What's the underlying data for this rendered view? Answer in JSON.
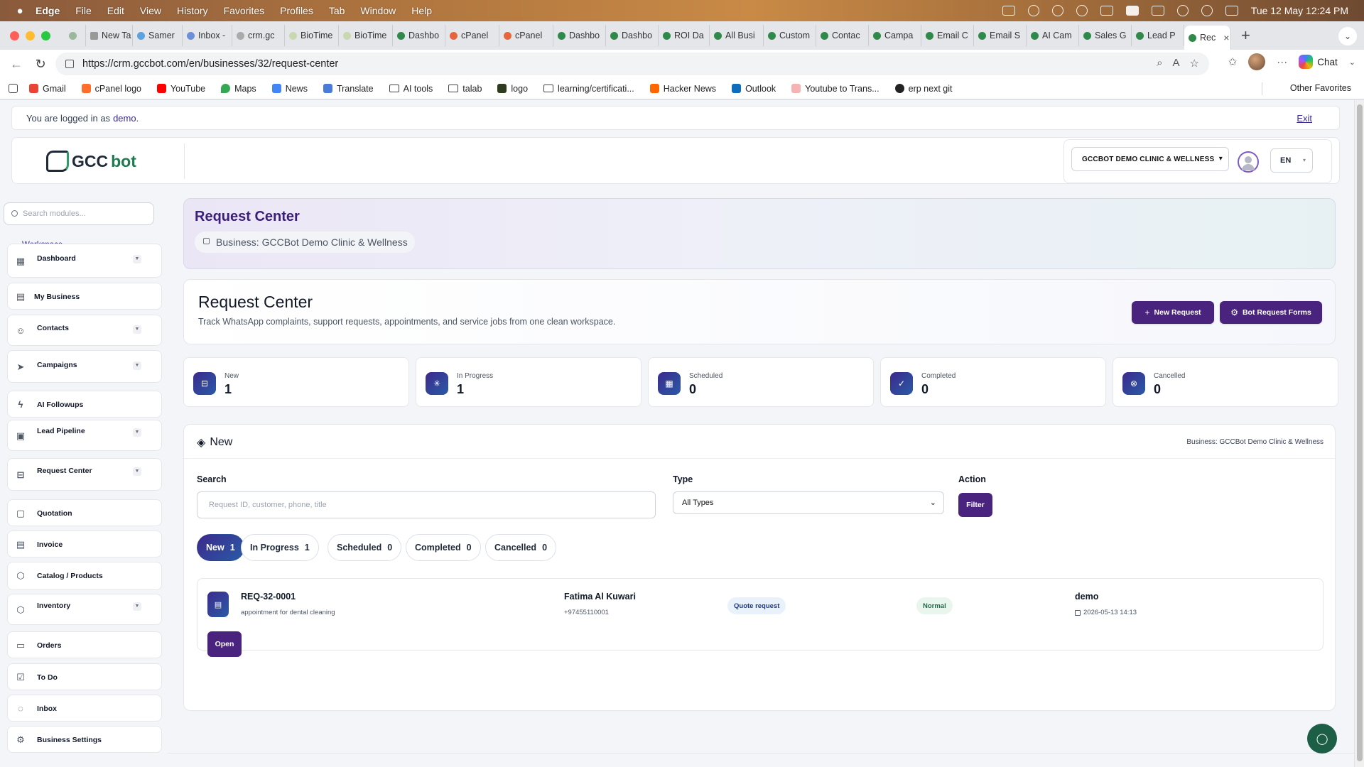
{
  "menubar": {
    "items": [
      "Edge",
      "File",
      "Edit",
      "View",
      "History",
      "Favorites",
      "Profiles",
      "Tab",
      "Window",
      "Help"
    ],
    "datetime": "Tue 12 May  12:24 PM"
  },
  "tabs": [
    "New Ta",
    "Samer",
    "Inbox -",
    "crm.gc",
    "BioTime",
    "BioTime",
    "Dashbo",
    "cPanel",
    "cPanel",
    "Dashbo",
    "Dashbo",
    "ROI Da",
    "All Busi",
    "Custom",
    "Contac",
    "Campa",
    "Email C",
    "Email S",
    "AI Cam",
    "Sales G",
    "Lead P"
  ],
  "active_tab": "Rec",
  "address": {
    "url": "https://crm.gccbot.com/en/businesses/32/request-center",
    "chat_label": "Chat"
  },
  "bookmarks": [
    "Gmail",
    "cPanel logo",
    "YouTube",
    "Maps",
    "News",
    "Translate",
    "AI tools",
    "talab",
    "logo",
    "learning/certificati...",
    "Hacker News",
    "Outlook",
    "Youtube to Trans...",
    "erp next git"
  ],
  "other_favorites": "Other Favorites",
  "login": {
    "prefix": "You are logged in as",
    "user": "demo",
    "suffix": ".",
    "exit": "Exit"
  },
  "header": {
    "logo_text_a": "GCC",
    "logo_text_b": "bot",
    "business_select": "GCCBOT DEMO CLINIC & WELLNESS",
    "language": "EN"
  },
  "sidebar": {
    "search_placeholder": "Search modules...",
    "section_label": "Workspace",
    "items": [
      {
        "label": "Dashboard",
        "icon": "grid-icon",
        "caret": true
      },
      {
        "label": "My Business",
        "icon": "building-icon",
        "caret": false
      },
      {
        "label": "Contacts",
        "icon": "users-icon",
        "caret": true
      },
      {
        "label": "Campaigns",
        "icon": "send-icon",
        "caret": true
      },
      {
        "label": "AI Followups",
        "icon": "bolt-icon",
        "caret": false
      },
      {
        "label": "Lead Pipeline",
        "icon": "briefcase-icon",
        "caret": true
      },
      {
        "label": "Request Center",
        "icon": "inbox-icon",
        "caret": true
      },
      {
        "label": "Quotation",
        "icon": "file-icon",
        "caret": false
      },
      {
        "label": "Invoice",
        "icon": "file-text-icon",
        "caret": false
      },
      {
        "label": "Catalog / Products",
        "icon": "box-icon",
        "caret": false
      },
      {
        "label": "Inventory",
        "icon": "package-icon",
        "caret": true
      },
      {
        "label": "Orders",
        "icon": "bag-icon",
        "caret": false
      },
      {
        "label": "To Do",
        "icon": "check-square-icon",
        "caret": false
      },
      {
        "label": "Inbox",
        "icon": "whatsapp-icon",
        "caret": false
      },
      {
        "label": "Business Settings",
        "icon": "gear-icon",
        "caret": false
      }
    ]
  },
  "hero": {
    "title": "Request Center",
    "business_chip": "Business: GCCBot Demo Clinic & Wellness"
  },
  "title_card": {
    "title": "Request Center",
    "subtitle": "Track WhatsApp complaints, support requests, appointments, and service jobs from one clean workspace.",
    "new_request": "New Request",
    "bot_forms": "Bot Request Forms"
  },
  "stats": [
    {
      "label": "New",
      "value": "1",
      "icon": "inbox-icon"
    },
    {
      "label": "In Progress",
      "value": "1",
      "icon": "spinner-icon"
    },
    {
      "label": "Scheduled",
      "value": "0",
      "icon": "calendar-icon"
    },
    {
      "label": "Completed",
      "value": "0",
      "icon": "check-circle-icon"
    },
    {
      "label": "Cancelled",
      "value": "0",
      "icon": "x-circle-icon"
    }
  ],
  "list": {
    "title": "New",
    "business": "Business: GCCBot Demo Clinic & Wellness",
    "search_label": "Search",
    "search_placeholder": "Request ID, customer, phone, title",
    "type_label": "Type",
    "type_value": "All Types",
    "action_label": "Action",
    "filter_button": "Filter",
    "pills": [
      {
        "label": "New",
        "count": "1",
        "active": true
      },
      {
        "label": "In Progress",
        "count": "1",
        "active": false
      },
      {
        "label": "Scheduled",
        "count": "0",
        "active": false
      },
      {
        "label": "Completed",
        "count": "0",
        "active": false
      },
      {
        "label": "Cancelled",
        "count": "0",
        "active": false
      }
    ],
    "rows": [
      {
        "id": "REQ-32-0001",
        "title": "appointment for dental cleaning",
        "customer": "Fatima Al Kuwari",
        "phone": "+97455110001",
        "type": "Quote request",
        "priority": "Normal",
        "user": "demo",
        "date": "2026-05-13 14:13",
        "open": "Open"
      }
    ]
  }
}
